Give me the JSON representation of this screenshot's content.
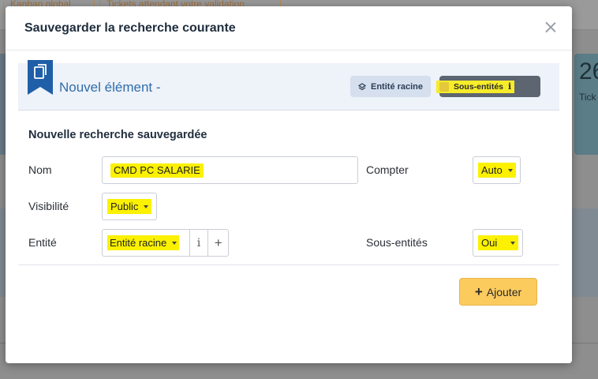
{
  "background": {
    "tab1": "Kanban global",
    "tab2": "Tickets attendant votre validation",
    "card_number": "26",
    "card_label": "Tick"
  },
  "modal": {
    "title": "Sauvegarder la recherche courante",
    "close_icon": "close-icon"
  },
  "item_header": {
    "title": "Nouvel élément -",
    "root_entity_badge": "Entité racine",
    "sub_entities_badge": "Sous-entités",
    "sub_entities_checked": true,
    "info_glyph": "i"
  },
  "form": {
    "section_title": "Nouvelle recherche sauvegardée",
    "name_label": "Nom",
    "name_value": "CMD PC SALARIE",
    "visibility_label": "Visibilité",
    "visibility_value": "Public",
    "entity_label": "Entité",
    "entity_value": "Entité racine",
    "entity_info": "i",
    "entity_add": "+",
    "count_label": "Compter",
    "count_value": "Auto",
    "sub_entities_label": "Sous-entités",
    "sub_entities_value": "Oui"
  },
  "actions": {
    "add_label": "Ajouter",
    "add_icon": "+"
  },
  "colors": {
    "highlight": "#fbf100",
    "accent_blue": "#2f6eaa",
    "add_button": "#fbcb5e",
    "dark_badge": "#5c6570"
  }
}
